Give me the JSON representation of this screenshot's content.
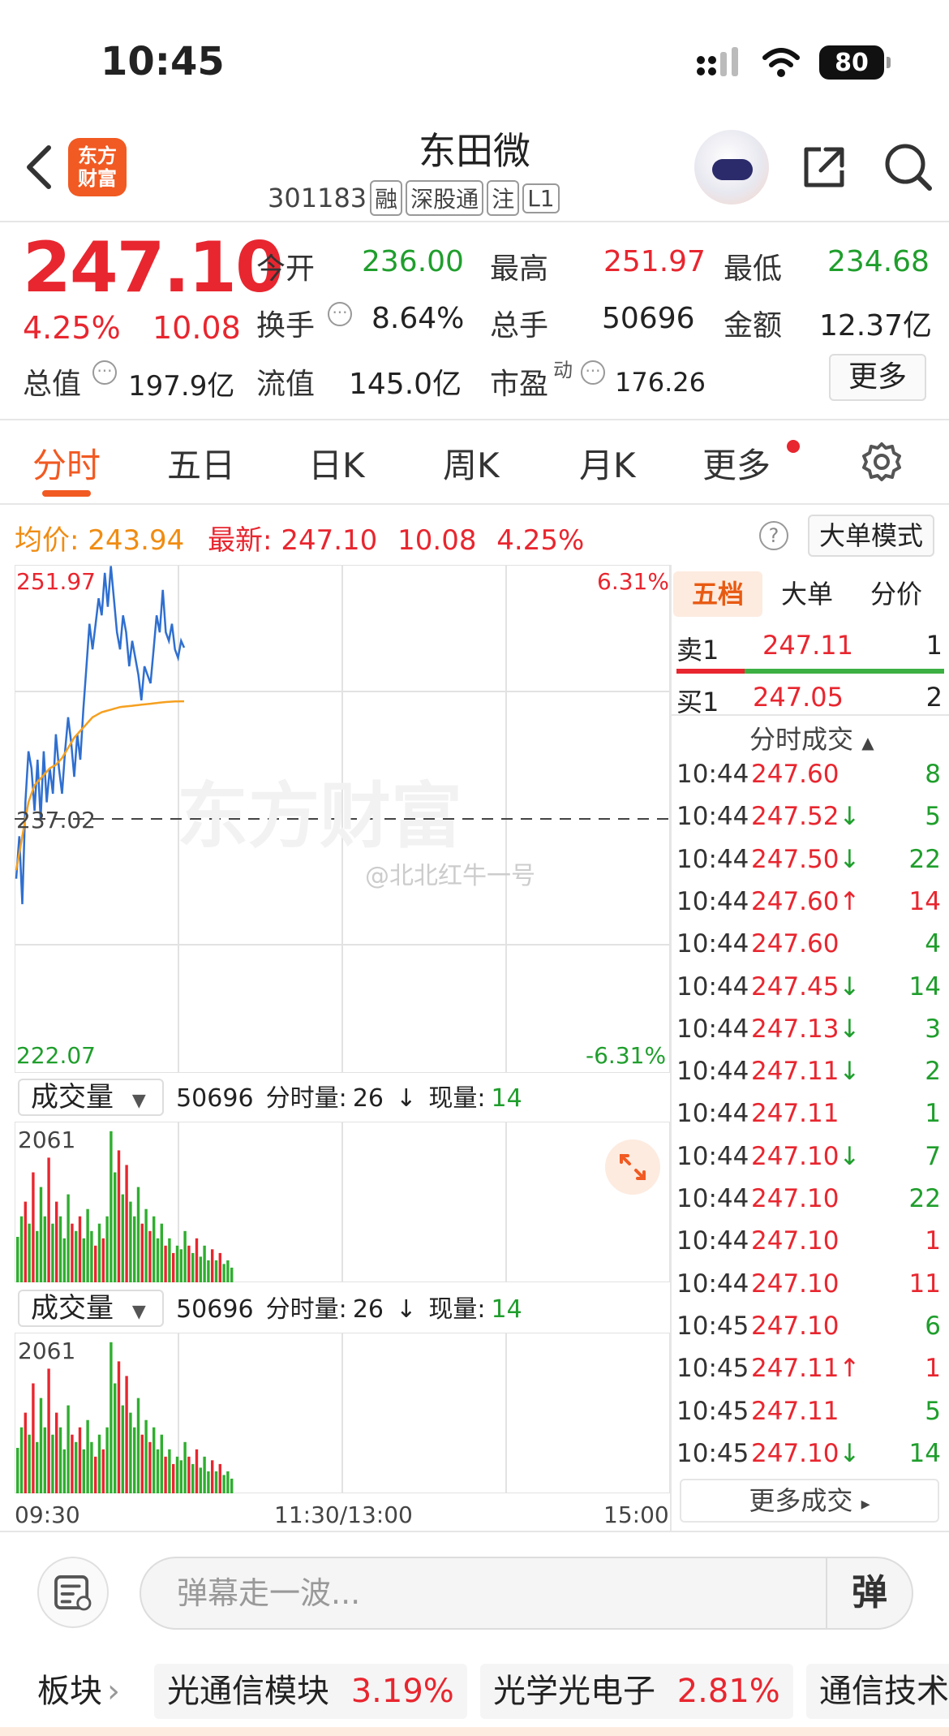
{
  "status_bar": {
    "time": "10:45",
    "battery": "80"
  },
  "header": {
    "stock_name": "东田微",
    "stock_code": "301183",
    "tags": [
      "融",
      "深股通",
      "注",
      "L1"
    ],
    "logo_line1": "东方",
    "logo_line2": "财富"
  },
  "quote": {
    "price": "247.10",
    "change_pct": "4.25%",
    "change": "10.08",
    "open_label": "今开",
    "open": "236.00",
    "high_label": "最高",
    "high": "251.97",
    "low_label": "最低",
    "low": "234.68",
    "turnover_label": "换手",
    "turnover": "8.64%",
    "volume_label": "总手",
    "volume": "50696",
    "amount_label": "金额",
    "amount": "12.37亿",
    "mktcap_label": "总值",
    "mktcap": "197.9亿",
    "float_label": "流值",
    "float": "145.0亿",
    "pe_label": "市盈",
    "pe_sup": "动",
    "pe": "176.26",
    "more_label": "更多"
  },
  "tabs": [
    "分时",
    "五日",
    "日K",
    "周K",
    "月K",
    "更多"
  ],
  "info_line": {
    "avg_label": "均价:",
    "avg": "243.94",
    "latest_label": "最新:",
    "latest": "247.10",
    "latest_chg": "10.08",
    "latest_pct": "4.25%",
    "big_order_label": "大单模式"
  },
  "chart_data": {
    "type": "line",
    "top_left": "251.97",
    "top_right": "6.31%",
    "mid_label": "237.02",
    "bottom_left": "222.07",
    "bottom_right": "-6.31%",
    "x_labels": [
      "09:30",
      "11:30/13:00",
      "15:00"
    ],
    "ylim": [
      222.07,
      251.97
    ],
    "prev_close": 237.02,
    "series": [
      {
        "values": [
          233.5,
          236.0,
          232.0,
          238.0,
          241.0,
          240.0,
          237.5,
          240.5,
          237.0,
          241.0,
          238.0,
          240.0,
          238.5,
          242.0,
          240.0,
          238.5,
          241.0,
          243.0,
          241.5,
          239.5,
          242.0,
          240.5,
          243.5,
          246.0,
          248.5,
          247.0,
          248.5,
          250.0,
          249.0,
          251.5,
          249.5,
          251.9,
          250.0,
          248.0,
          247.0,
          249.0,
          248.0,
          246.0,
          247.5,
          246.5,
          245.5,
          244.0,
          246.0,
          245.5,
          245.0,
          247.0,
          249.0,
          248.0,
          250.5,
          248.0,
          247.5,
          248.5,
          247.0,
          246.5,
          247.5,
          247.1
        ]
      },
      {
        "values": [
          234.0,
          235.0,
          236.0,
          237.0,
          238.0,
          238.5,
          239.0,
          239.2,
          239.4,
          239.6,
          239.8,
          240.0,
          240.1,
          240.2,
          240.4,
          240.6,
          240.9,
          241.2,
          241.5,
          241.8,
          242.0,
          242.2,
          242.4,
          242.6,
          242.8,
          243.0,
          243.1,
          243.2,
          243.3,
          243.35,
          243.4,
          243.45,
          243.5,
          243.55,
          243.6,
          243.62,
          243.64,
          243.66,
          243.68,
          243.7,
          243.72,
          243.74,
          243.76,
          243.78,
          243.8,
          243.82,
          243.84,
          243.86,
          243.88,
          243.9,
          243.91,
          243.92,
          243.93,
          243.935,
          243.94,
          243.94
        ]
      }
    ],
    "volume_max_label": "2061",
    "volume": [
      620,
      900,
      1100,
      800,
      1500,
      700,
      1300,
      900,
      1700,
      800,
      1100,
      900,
      600,
      1200,
      800,
      700,
      900,
      600,
      1000,
      700,
      500,
      800,
      600,
      900,
      2061,
      1500,
      1800,
      1200,
      1600,
      1100,
      900,
      1300,
      800,
      1000,
      700,
      900,
      600,
      800,
      500,
      600,
      400,
      500,
      450,
      700,
      500,
      400,
      600,
      350,
      500,
      300,
      450,
      300,
      400,
      250,
      300,
      200
    ]
  },
  "volume_panel": {
    "selector": "成交量",
    "total": "50696",
    "min_vol_label": "分时量:",
    "min_vol": "26",
    "cur_label": "现量:",
    "cur": "14"
  },
  "side_panel": {
    "tabs": [
      "五档",
      "大单",
      "分价"
    ],
    "sell1_label": "卖1",
    "sell1_price": "247.11",
    "sell1_vol": "1",
    "buy1_label": "买1",
    "buy1_price": "247.05",
    "buy1_vol": "2",
    "ticks_title": "分时成交",
    "ticks": [
      {
        "time": "10:44",
        "price": "247.60",
        "dir": "",
        "vol": "8",
        "vc": "green"
      },
      {
        "time": "10:44",
        "price": "247.52",
        "dir": "↓",
        "vol": "5",
        "vc": "green"
      },
      {
        "time": "10:44",
        "price": "247.50",
        "dir": "↓",
        "vol": "22",
        "vc": "green"
      },
      {
        "time": "10:44",
        "price": "247.60",
        "dir": "↑",
        "vol": "14",
        "vc": "red"
      },
      {
        "time": "10:44",
        "price": "247.60",
        "dir": "",
        "vol": "4",
        "vc": "green"
      },
      {
        "time": "10:44",
        "price": "247.45",
        "dir": "↓",
        "vol": "14",
        "vc": "green"
      },
      {
        "time": "10:44",
        "price": "247.13",
        "dir": "↓",
        "vol": "3",
        "vc": "green"
      },
      {
        "time": "10:44",
        "price": "247.11",
        "dir": "↓",
        "vol": "2",
        "vc": "green"
      },
      {
        "time": "10:44",
        "price": "247.11",
        "dir": "",
        "vol": "1",
        "vc": "green"
      },
      {
        "time": "10:44",
        "price": "247.10",
        "dir": "↓",
        "vol": "7",
        "vc": "green"
      },
      {
        "time": "10:44",
        "price": "247.10",
        "dir": "",
        "vol": "22",
        "vc": "green"
      },
      {
        "time": "10:44",
        "price": "247.10",
        "dir": "",
        "vol": "1",
        "vc": "red"
      },
      {
        "time": "10:44",
        "price": "247.10",
        "dir": "",
        "vol": "11",
        "vc": "red"
      },
      {
        "time": "10:45",
        "price": "247.10",
        "dir": "",
        "vol": "6",
        "vc": "green"
      },
      {
        "time": "10:45",
        "price": "247.11",
        "dir": "↑",
        "vol": "1",
        "vc": "red"
      },
      {
        "time": "10:45",
        "price": "247.11",
        "dir": "",
        "vol": "5",
        "vc": "green"
      },
      {
        "time": "10:45",
        "price": "247.10",
        "dir": "↓",
        "vol": "14",
        "vc": "green"
      }
    ],
    "more_trades": "更多成交"
  },
  "barrage": {
    "placeholder": "弹幕走一波...",
    "toggle": "弹"
  },
  "sectors": {
    "label": "板块",
    "items": [
      {
        "name": "光通信模块",
        "pct": "3.19%"
      },
      {
        "name": "光学光电子",
        "pct": "2.81%"
      },
      {
        "name": "通信技术",
        "pct": ""
      }
    ]
  },
  "colors": {
    "accent": "#f15a22",
    "up": "#e8262f",
    "down": "#1f9e2c",
    "price_line": "#2f6fd0",
    "avg_line": "#f5a020"
  }
}
